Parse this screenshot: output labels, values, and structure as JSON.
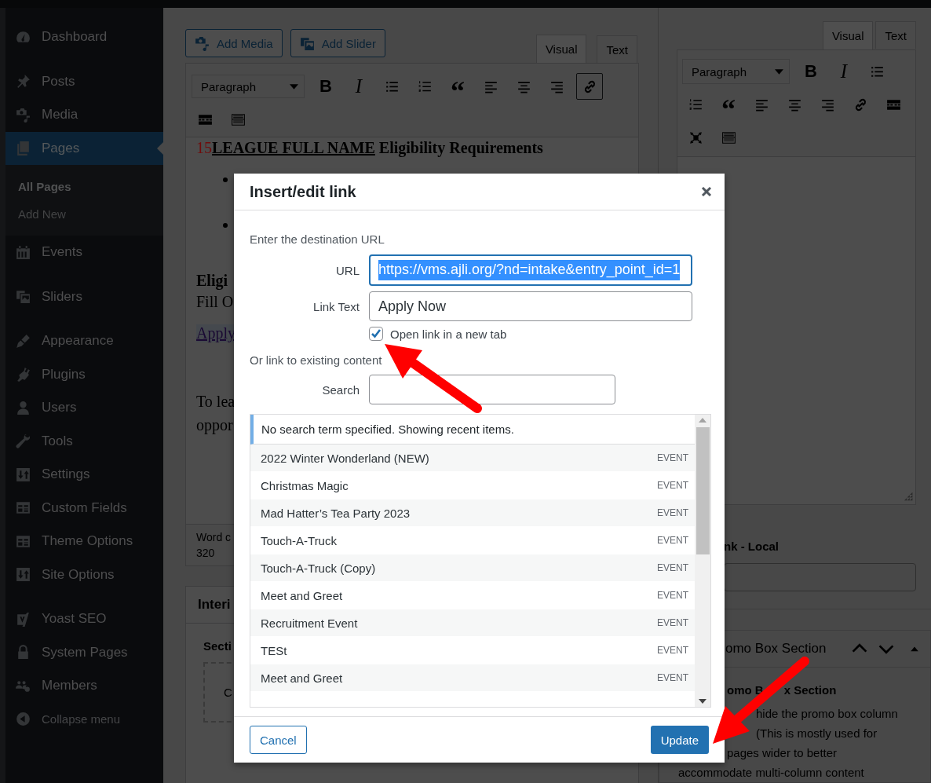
{
  "sidebar": {
    "items": [
      {
        "kind": "item",
        "label": "Dashboard",
        "selected": false
      },
      {
        "kind": "separator"
      },
      {
        "kind": "item",
        "label": "Posts",
        "selected": false
      },
      {
        "kind": "item",
        "label": "Media",
        "selected": false
      },
      {
        "kind": "item",
        "label": "Pages",
        "selected": true,
        "children": [
          {
            "label": "All Pages",
            "selected": true
          },
          {
            "label": "Add New",
            "selected": false
          }
        ]
      },
      {
        "kind": "item",
        "label": "Events",
        "selected": false
      },
      {
        "kind": "separator"
      },
      {
        "kind": "item",
        "label": "Sliders",
        "selected": false
      },
      {
        "kind": "separator"
      },
      {
        "kind": "item",
        "label": "Appearance",
        "selected": false
      },
      {
        "kind": "item",
        "label": "Plugins",
        "selected": false
      },
      {
        "kind": "item",
        "label": "Users",
        "selected": false
      },
      {
        "kind": "item",
        "label": "Tools",
        "selected": false
      },
      {
        "kind": "item",
        "label": "Settings",
        "selected": false
      },
      {
        "kind": "item",
        "label": "Custom Fields",
        "selected": false
      },
      {
        "kind": "item",
        "label": "Theme Options",
        "selected": false
      },
      {
        "kind": "item",
        "label": "Site Options",
        "selected": false
      },
      {
        "kind": "separator"
      },
      {
        "kind": "item",
        "label": "Yoast SEO",
        "selected": false
      },
      {
        "kind": "item",
        "label": "System Pages",
        "selected": false
      },
      {
        "kind": "item",
        "label": "Members",
        "selected": false
      },
      {
        "kind": "collapse",
        "label": "Collapse menu"
      }
    ]
  },
  "editor": {
    "media_buttons": [
      "Add Media",
      "Add Slider"
    ],
    "tabs": [
      {
        "label": "Visual",
        "selected": true
      },
      {
        "label": "Text",
        "selected": false
      }
    ],
    "format": "Paragraph",
    "toolbar_rows": [
      [
        {
          "kind": "bold",
          "glyph": "B",
          "active": false
        },
        {
          "kind": "italic",
          "glyph": "I",
          "active": false
        },
        {
          "kind": "ul",
          "active": false
        },
        {
          "kind": "ol",
          "active": false
        },
        {
          "kind": "quote",
          "glyph": "“",
          "active": false
        },
        {
          "kind": "align-left",
          "active": false
        },
        {
          "kind": "align-center",
          "active": false
        },
        {
          "kind": "align-right",
          "active": false
        },
        {
          "kind": "link",
          "active": true
        }
      ],
      [
        {
          "kind": "readmore",
          "active": false
        },
        {
          "kind": "keyboard",
          "active": false
        }
      ]
    ],
    "content": {
      "heading": {
        "number": "15",
        "underlined": "LEAGUE FULL NAME",
        "rest": "Eligibility Requirements"
      },
      "bullets": [
        {
          "kind": "bullet"
        },
        {
          "kind": "bullet"
        }
      ],
      "subheading": "Eligi",
      "paragraph": "Fill O",
      "link": "Apply",
      "closing": [
        "To lea",
        "oppor"
      ]
    },
    "word_count": {
      "label": "Word c",
      "value": "320"
    }
  },
  "interior_box": {
    "title": "Interi",
    "section_label": "Secti",
    "drop_zone_text": "C"
  },
  "right_panel": {
    "tabs": [
      {
        "label": "Visual",
        "selected": true
      },
      {
        "label": "Text",
        "selected": false
      }
    ],
    "format": "Paragraph",
    "toolbar_rows": [
      [
        {
          "kind": "bold",
          "glyph": "B",
          "active": false
        },
        {
          "kind": "italic",
          "glyph": "I",
          "active": false
        },
        {
          "kind": "ul",
          "active": false
        }
      ],
      [
        {
          "kind": "ol",
          "active": false
        },
        {
          "kind": "quote",
          "glyph": "“",
          "active": false
        },
        {
          "kind": "align-left",
          "active": false
        },
        {
          "kind": "align-center",
          "active": false
        },
        {
          "kind": "align-right",
          "active": false
        },
        {
          "kind": "link",
          "active": false
        },
        {
          "kind": "readmore",
          "active": false
        }
      ],
      [
        {
          "kind": "fullscreen",
          "active": false
        },
        {
          "kind": "keyboard",
          "active": false
        }
      ]
    ],
    "link_field": {
      "label": "nk - Local"
    },
    "promo_box": {
      "title": "omo Box Section",
      "subtitle": [
        "omo B",
        "x Section"
      ],
      "description": [
        "hide the promo box column",
        "(This is mostly used for",
        "pages wider to better",
        "accommodate multi-column content"
      ]
    }
  },
  "dialog": {
    "title": "Insert/edit link",
    "intro": "Enter the destination URL",
    "url": {
      "label": "URL",
      "value": "https://vms.ajli.org/?nd=intake&entry_point_id=1",
      "text_selected": true
    },
    "link_text": {
      "label": "Link Text",
      "value": "Apply Now"
    },
    "new_tab": {
      "label": "Open link in a new tab",
      "checked": true
    },
    "existing_heading": "Or link to existing content",
    "search": {
      "label": "Search"
    },
    "notice": "No search term specified. Showing recent items.",
    "results": [
      {
        "title": "2022 Winter Wonderland (NEW)",
        "type": "EVENT"
      },
      {
        "title": "Christmas Magic",
        "type": "EVENT"
      },
      {
        "title": "Mad Hatter’s Tea Party 2023",
        "type": "EVENT"
      },
      {
        "title": "Touch-A-Truck",
        "type": "EVENT"
      },
      {
        "title": "Touch-A-Truck (Copy)",
        "type": "EVENT"
      },
      {
        "title": "Meet and Greet",
        "type": "EVENT"
      },
      {
        "title": "Recruitment Event",
        "type": "EVENT"
      },
      {
        "title": "TESt",
        "type": "EVENT"
      },
      {
        "title": "Meet and Greet",
        "type": "EVENT"
      }
    ],
    "cancel": "Cancel",
    "update": "Update"
  }
}
